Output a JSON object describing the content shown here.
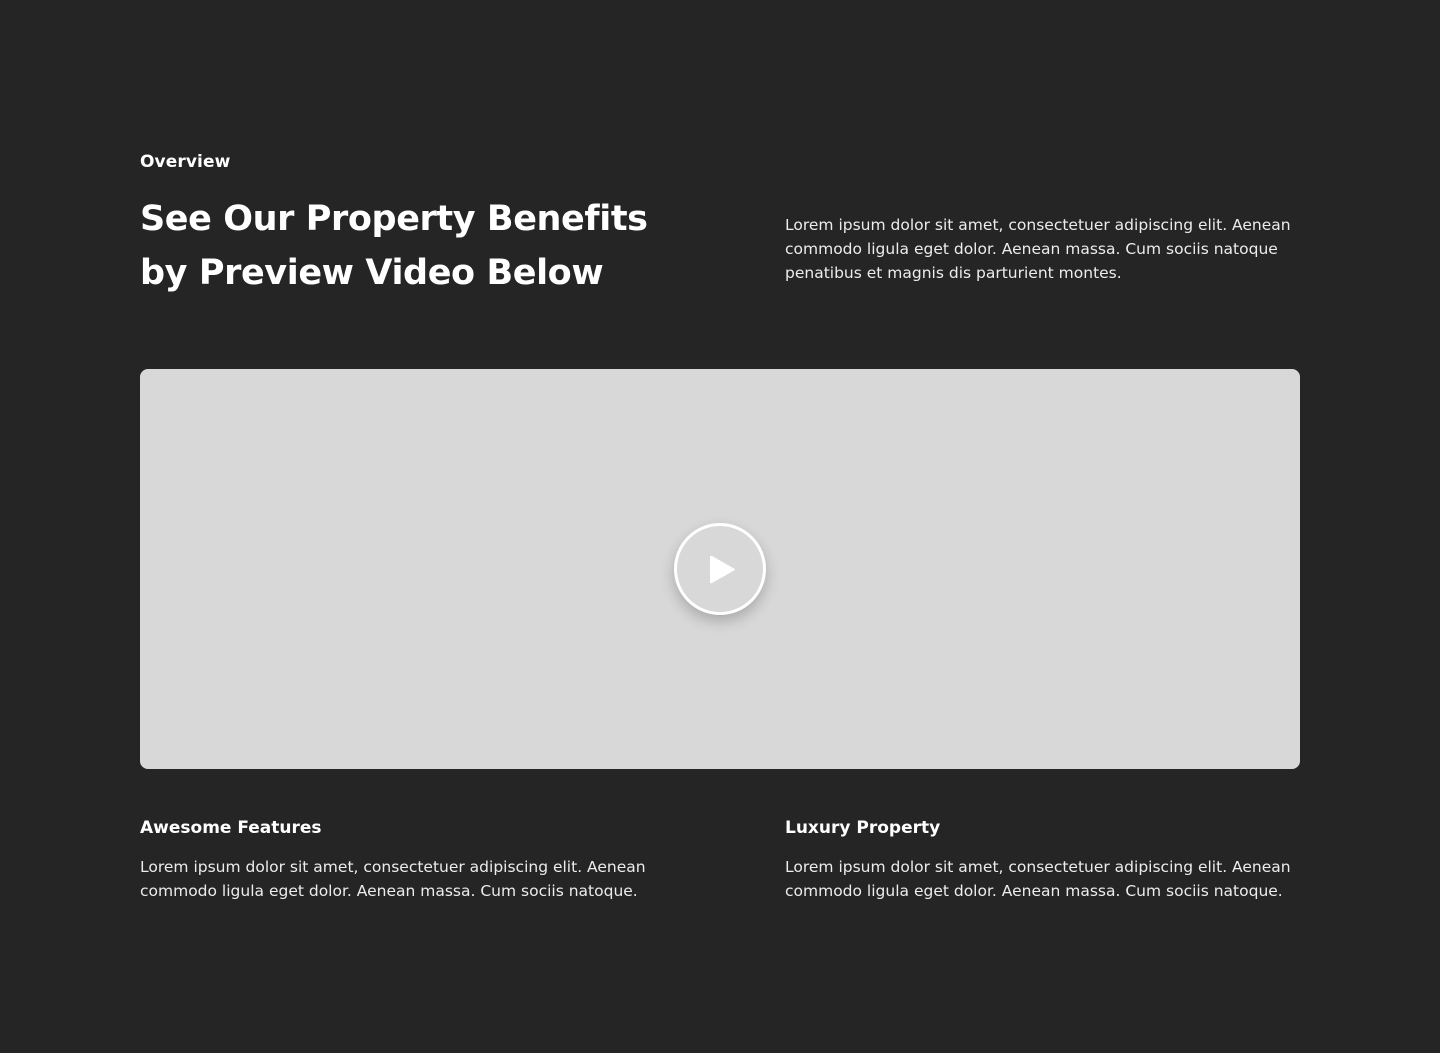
{
  "section": {
    "eyebrow": "Overview",
    "headline": "See Our Property Benefits by Preview Video Below",
    "intro": "Lorem ipsum dolor sit amet, consectetuer adipiscing elit. Aenean commodo ligula eget dolor. Aenean massa. Cum sociis natoque penatibus et magnis dis parturient montes."
  },
  "video": {
    "icon": "play-icon",
    "placeholder_color": "#d8d8d8"
  },
  "features": [
    {
      "title": "Awesome Features",
      "text": "Lorem ipsum dolor sit amet, consectetuer adipiscing elit. Aenean commodo ligula eget dolor. Aenean massa. Cum sociis natoque."
    },
    {
      "title": "Luxury Property",
      "text": "Lorem ipsum dolor sit amet, consectetuer adipiscing elit. Aenean commodo ligula eget dolor. Aenean massa. Cum sociis natoque."
    }
  ],
  "colors": {
    "background": "#252525",
    "text": "#ffffff"
  }
}
